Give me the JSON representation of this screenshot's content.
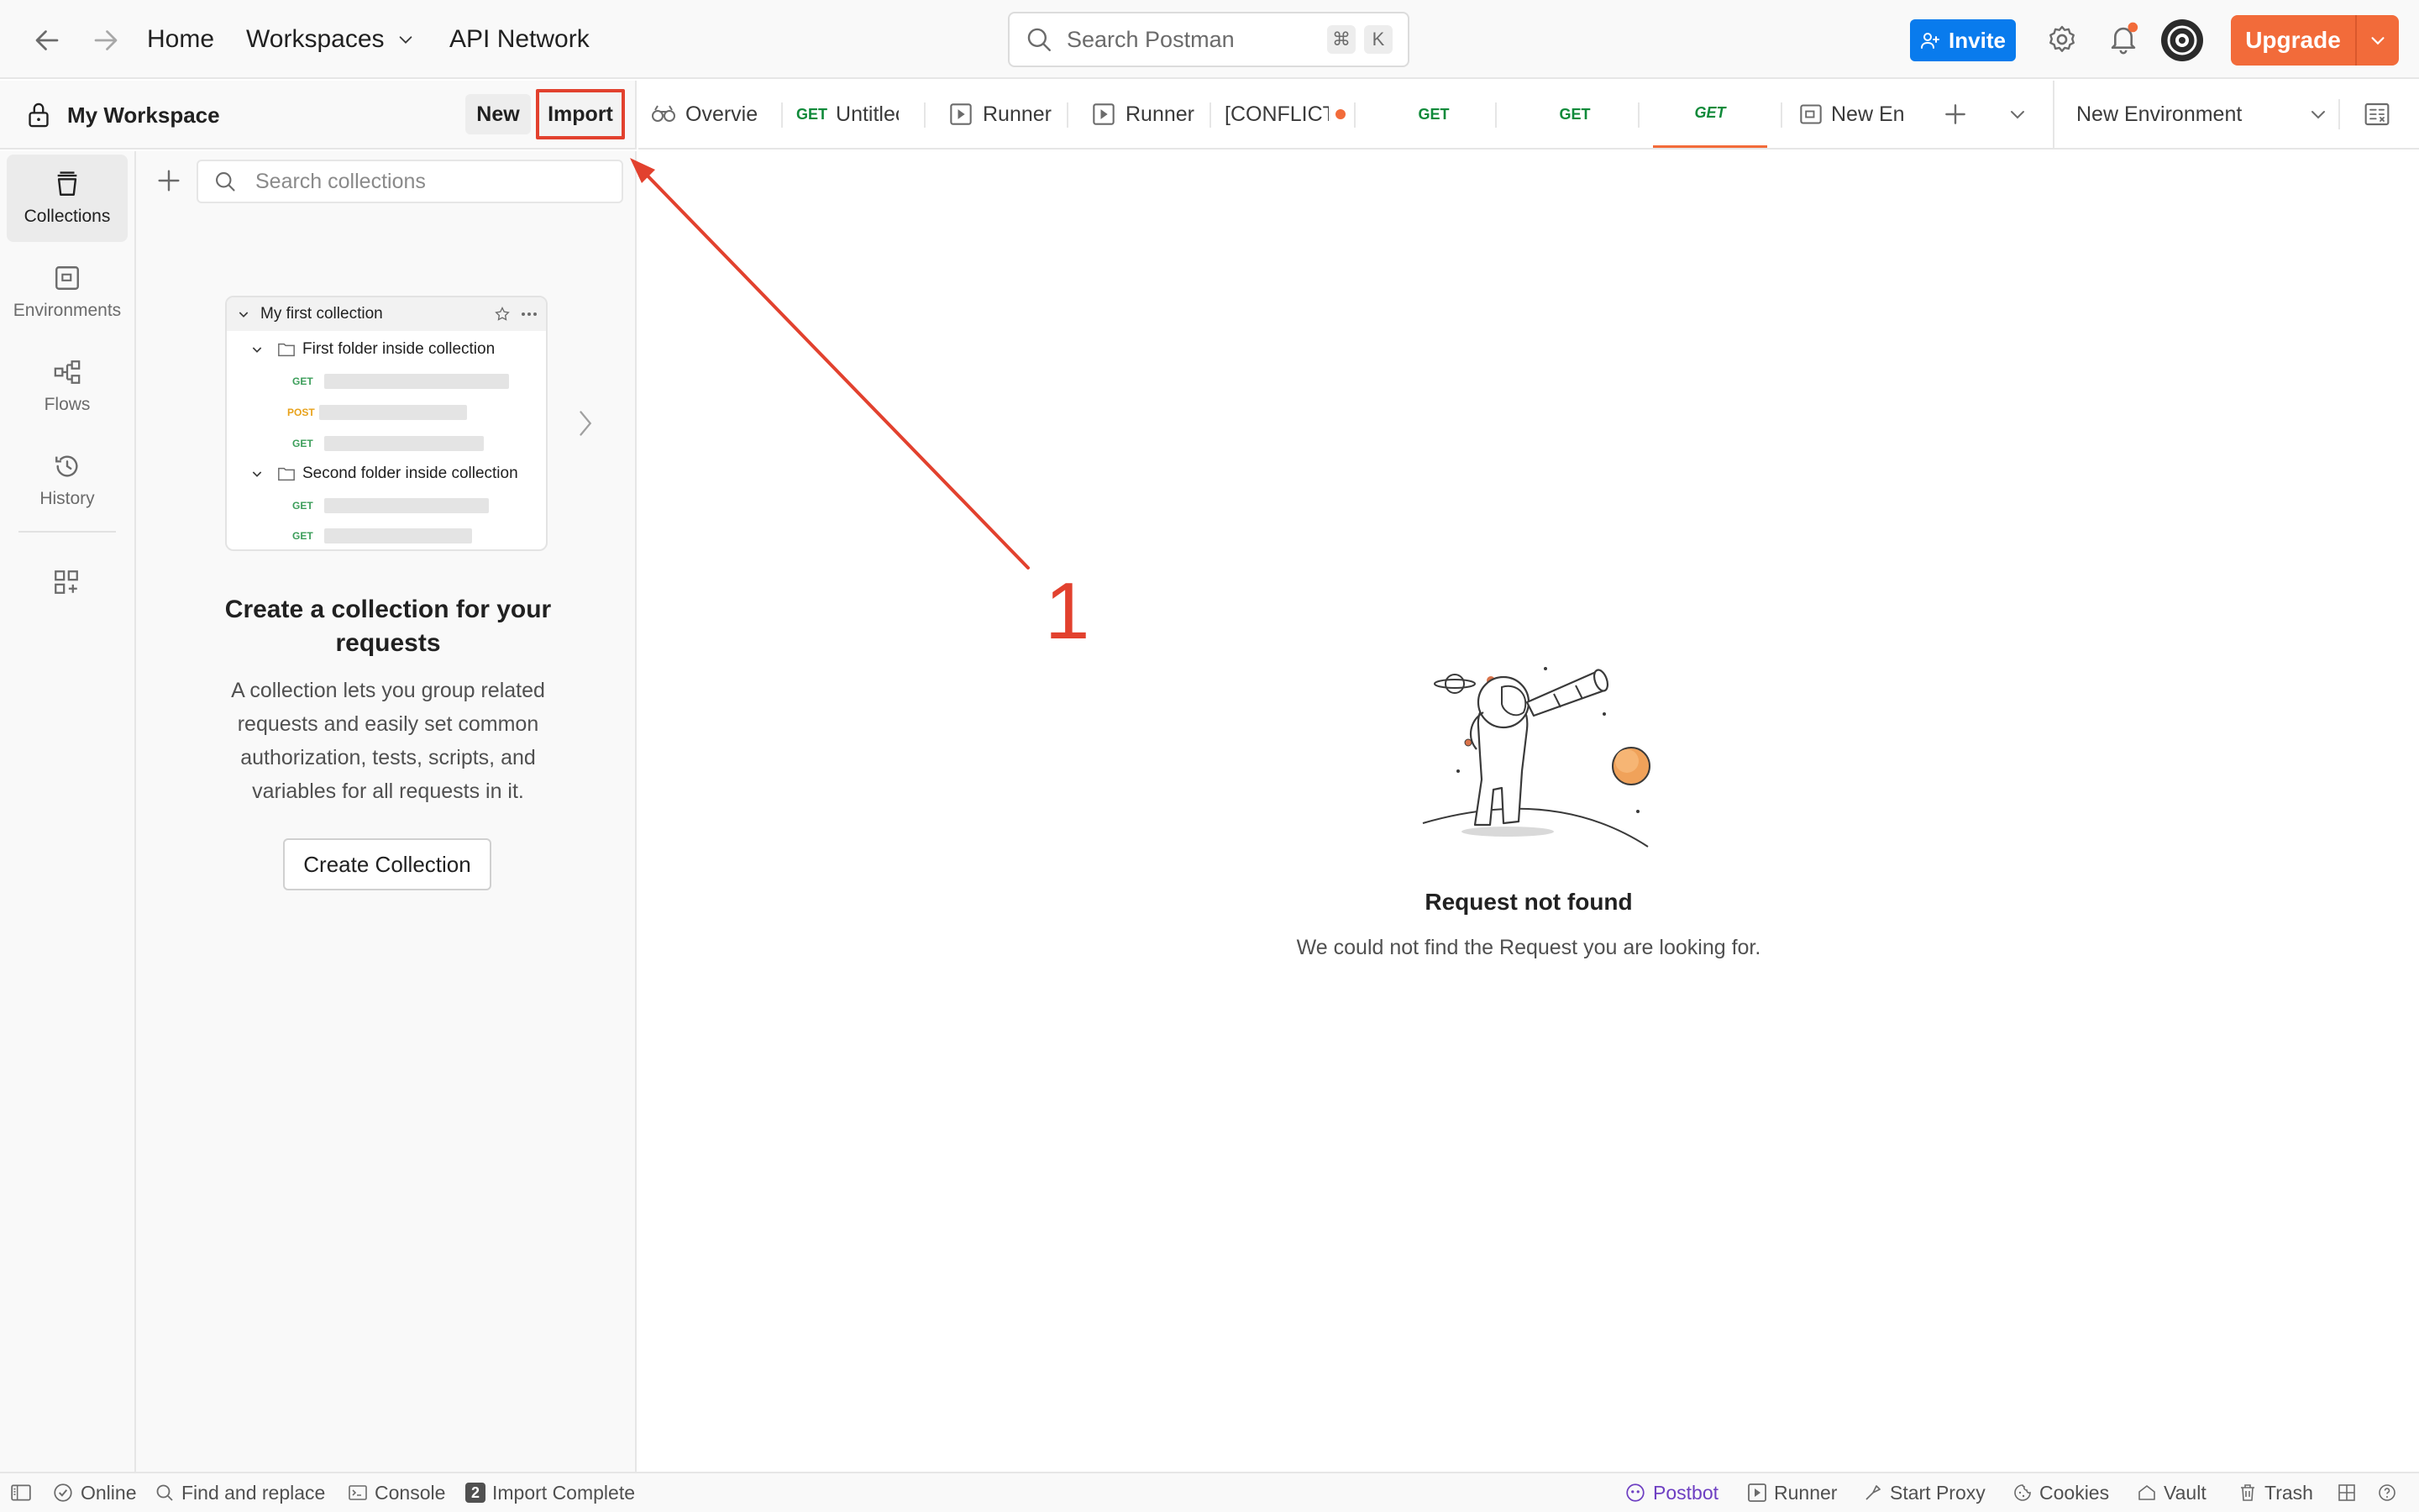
{
  "header": {
    "nav_home": "Home",
    "nav_workspaces": "Workspaces",
    "nav_api_network": "API Network",
    "search_placeholder": "Search Postman",
    "shortcut_cmd": "⌘",
    "shortcut_key": "K",
    "invite_label": "Invite",
    "upgrade_label": "Upgrade",
    "notification_dot": true
  },
  "workspace": {
    "name": "My Workspace",
    "new_label": "New",
    "import_label": "Import"
  },
  "tabs": [
    {
      "label": "Overvie",
      "icon": "overview-icon"
    },
    {
      "method": "GET",
      "label": "Untitlec"
    },
    {
      "label": "Runner",
      "icon": "runner-icon"
    },
    {
      "label": "Runner",
      "icon": "runner-icon"
    },
    {
      "label": "[CONFLICT",
      "unsaved": true
    },
    {
      "method": "GET",
      "label": ""
    },
    {
      "method": "GET",
      "label": ""
    },
    {
      "method": "GET",
      "label": "",
      "active": true
    },
    {
      "label": "New En",
      "icon": "environment-icon"
    }
  ],
  "environment": {
    "selected": "New Environment"
  },
  "rail": [
    {
      "label": "Collections",
      "icon": "collections-icon",
      "active": true
    },
    {
      "label": "Environments",
      "icon": "environments-icon"
    },
    {
      "label": "Flows",
      "icon": "flows-icon"
    },
    {
      "label": "History",
      "icon": "history-icon"
    }
  ],
  "collections_panel": {
    "search_placeholder": "Search collections",
    "preview": {
      "collection": "My first collection",
      "folder1": "First folder inside collection",
      "folder2": "Second folder inside collection",
      "methods": [
        "GET",
        "POST",
        "GET",
        "GET",
        "GET"
      ]
    },
    "empty_title": "Create a collection for your requests",
    "empty_description": "A collection lets you group related requests and easily set common authorization, tests, scripts, and variables for all requests in it.",
    "create_button": "Create Collection"
  },
  "main": {
    "title": "Request not found",
    "message": "We could not find the Request you are looking for."
  },
  "annotation": {
    "number": "1",
    "color": "#e2412e"
  },
  "statusbar": {
    "online": "Online",
    "find_replace": "Find and replace",
    "console": "Console",
    "import_badge": "2",
    "import_complete": "Import Complete",
    "postbot": "Postbot",
    "runner": "Runner",
    "start_proxy": "Start Proxy",
    "cookies": "Cookies",
    "vault": "Vault",
    "trash": "Trash"
  },
  "colors": {
    "brand_orange": "#f26b3a",
    "invite_blue": "#097bed",
    "get_green": "#0f8a3a",
    "post_yellow": "#e8a21b"
  }
}
